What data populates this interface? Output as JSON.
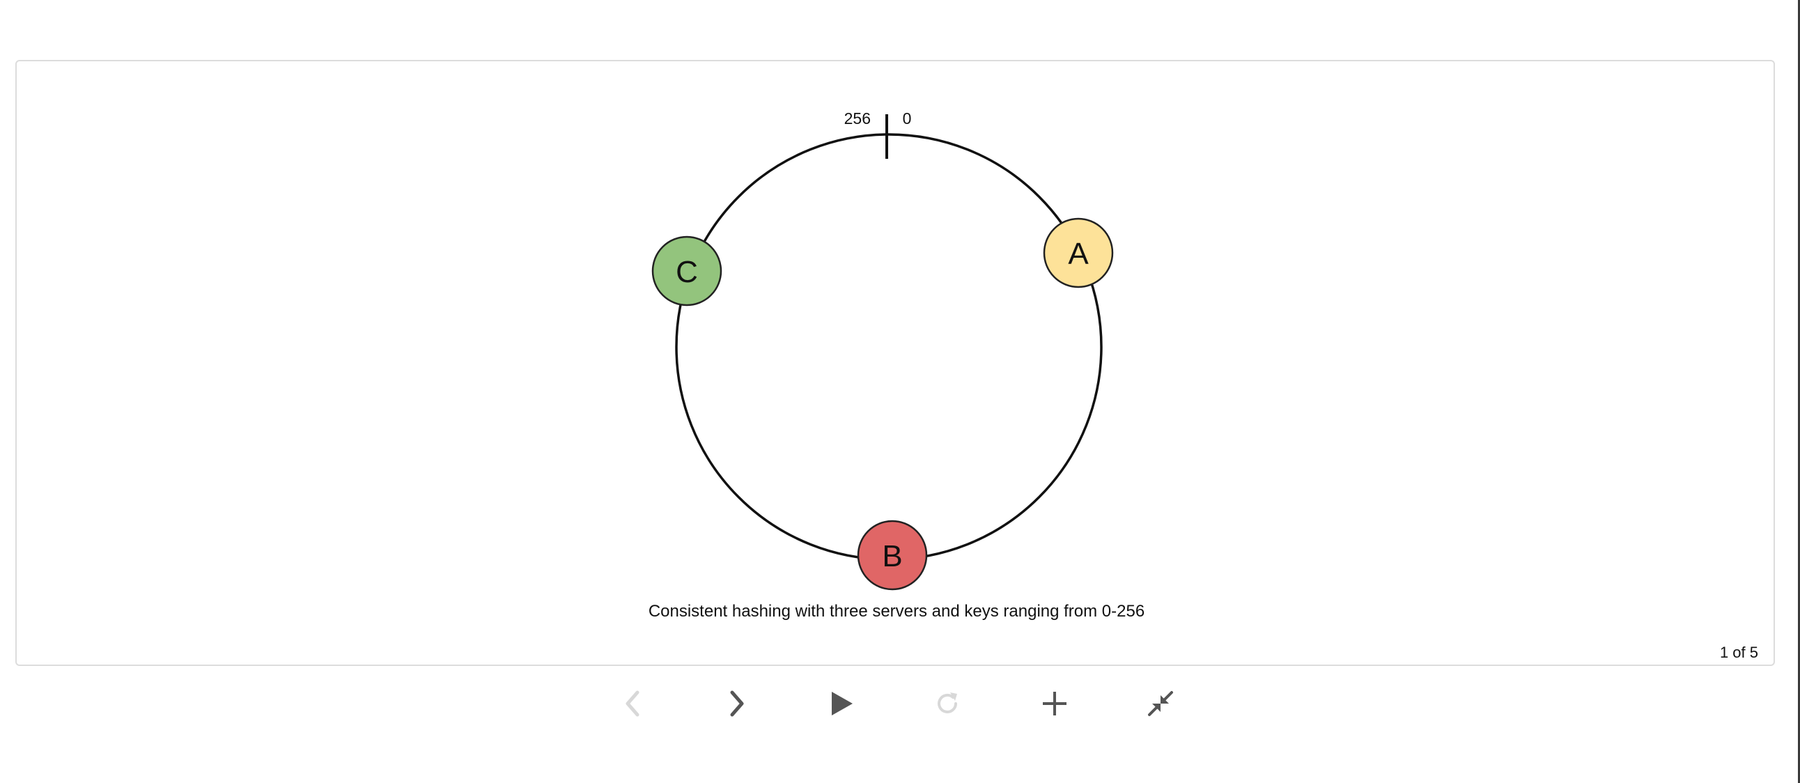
{
  "diagram": {
    "ring": {
      "tick_left_label": "256",
      "tick_right_label": "0"
    },
    "nodes": [
      {
        "label": "A",
        "color": "#fde299"
      },
      {
        "label": "B",
        "color": "#e06666"
      },
      {
        "label": "C",
        "color": "#93c47d"
      }
    ],
    "caption": "Consistent hashing with three servers and keys ranging from 0-256"
  },
  "slideshow": {
    "counter": "1 of 5"
  },
  "controls": {
    "prev_icon": "chevron-left-icon",
    "next_icon": "chevron-right-icon",
    "play_icon": "play-icon",
    "repeat_icon": "repeat-icon",
    "add_icon": "plus-icon",
    "collapse_icon": "collapse-icon",
    "active_color": "#555555",
    "disabled_color": "#d8d8d8"
  }
}
